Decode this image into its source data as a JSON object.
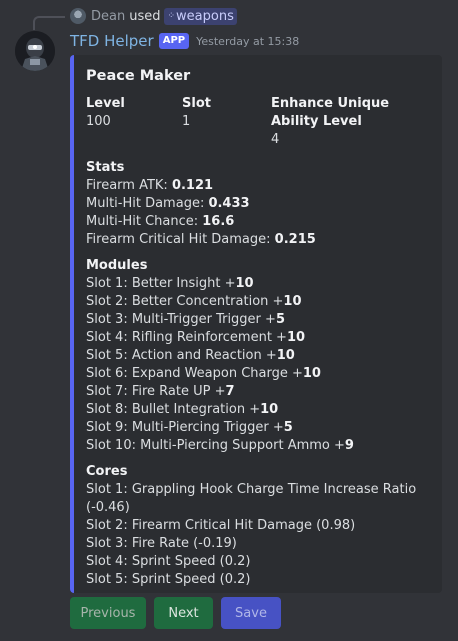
{
  "reply": {
    "user": "Dean",
    "used_text": "used",
    "command": "weapons"
  },
  "message": {
    "bot_name": "TFD Helper",
    "app_tag": "APP",
    "timestamp": "Yesterday at 15:38"
  },
  "embed": {
    "accent_color": "#5865f2",
    "title": "Peace Maker",
    "fields": {
      "level": {
        "name": "Level",
        "value": "100"
      },
      "slot": {
        "name": "Slot",
        "value": "1"
      },
      "enhance": {
        "name_line1": "Enhance Unique",
        "name_line2": "Ability Level",
        "value": "4"
      }
    },
    "stats": {
      "heading": "Stats",
      "items": [
        {
          "label": "Firearm ATK: ",
          "value": "0.121"
        },
        {
          "label": "Multi-Hit Damage: ",
          "value": "0.433"
        },
        {
          "label": "Multi-Hit Chance: ",
          "value": "16.6"
        },
        {
          "label": "Firearm Critical Hit Damage: ",
          "value": "0.215"
        }
      ]
    },
    "modules": {
      "heading": "Modules",
      "items": [
        {
          "label": "Slot 1: Better Insight +",
          "value": "10"
        },
        {
          "label": "Slot 2: Better Concentration +",
          "value": "10"
        },
        {
          "label": "Slot 3: Multi-Trigger Trigger +",
          "value": "5"
        },
        {
          "label": "Slot 4: Rifling Reinforcement +",
          "value": "10"
        },
        {
          "label": "Slot 5: Action and Reaction +",
          "value": "10"
        },
        {
          "label": "Slot 6: Expand Weapon Charge +",
          "value": "10"
        },
        {
          "label": "Slot 7: Fire Rate UP +",
          "value": "7"
        },
        {
          "label": "Slot 8: Bullet Integration +",
          "value": "10"
        },
        {
          "label": "Slot 9: Multi-Piercing Trigger +",
          "value": "5"
        },
        {
          "label": "Slot 10: Multi-Piercing Support Ammo +",
          "value": "9"
        }
      ]
    },
    "cores": {
      "heading": "Cores",
      "items": [
        "Slot 1: Grappling Hook Charge Time Increase Ratio (-0.46)",
        "Slot 2: Firearm Critical Hit Damage (0.98)",
        "Slot 3: Fire Rate (-0.19)",
        "Slot 4: Sprint Speed (0.2)",
        "Slot 5: Sprint Speed (0.2)"
      ]
    }
  },
  "buttons": {
    "previous": "Previous",
    "next": "Next",
    "save": "Save"
  }
}
